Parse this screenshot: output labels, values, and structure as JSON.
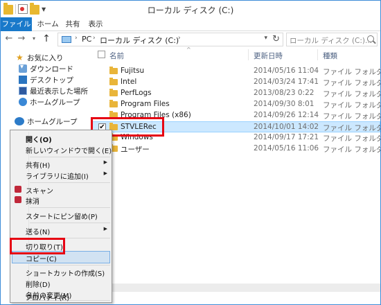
{
  "window": {
    "title": "ローカル ディスク (C:)"
  },
  "ribbon": {
    "tabs": [
      "ファイル",
      "ホーム",
      "共有",
      "表示"
    ]
  },
  "address": {
    "root_label": "PC",
    "current_label": "ローカル ディスク (C:)",
    "search_placeholder": "ローカル ディスク (C:)..."
  },
  "navpane": {
    "favorites": "お気に入り",
    "items": [
      "ダウンロード",
      "デスクトップ",
      "最近表示した場所",
      "ホームグループ"
    ],
    "homegroup": "ホームグループ"
  },
  "filelist": {
    "headers": {
      "name": "名前",
      "date": "更新日時",
      "type": "種類"
    },
    "rows": [
      {
        "name": "Fujitsu",
        "date": "2014/05/16 11:04",
        "type": "ファイル フォルダー"
      },
      {
        "name": "Intel",
        "date": "2014/03/24 17:41",
        "type": "ファイル フォルダー"
      },
      {
        "name": "PerfLogs",
        "date": "2013/08/23 0:22",
        "type": "ファイル フォルダー"
      },
      {
        "name": "Program Files",
        "date": "2014/09/30 8:01",
        "type": "ファイル フォルダー"
      },
      {
        "name": "Program Files (x86)",
        "date": "2014/09/26 12:14",
        "type": "ファイル フォルダー"
      },
      {
        "name": "STVLERec",
        "date": "2014/10/01 14:02",
        "type": "ファイル フォルダー",
        "selected": true
      },
      {
        "name": "Windows",
        "date": "2014/09/17 17:21",
        "type": "ファイル フォルダー"
      },
      {
        "name": "ユーザー",
        "date": "2014/05/16 11:06",
        "type": "ファイル フォルダー"
      }
    ]
  },
  "context_menu": {
    "items": [
      {
        "label": "開く(O)",
        "bold": true
      },
      {
        "label": "新しいウィンドウで開く(E)"
      },
      {
        "label": "共有(H)",
        "submenu": true
      },
      {
        "label": "ライブラリに追加(I)",
        "submenu": true
      },
      {
        "label": "スキャン",
        "icon": "antivirus-icon"
      },
      {
        "label": "抹消",
        "icon": "antivirus-icon"
      },
      {
        "label": "スタートにピン留め(P)"
      },
      {
        "label": "送る(N)",
        "submenu": true
      },
      {
        "label": "切り取り(T)"
      },
      {
        "label": "コピー(C)",
        "highlighted": true
      },
      {
        "label": "ショートカットの作成(S)"
      },
      {
        "label": "削除(D)"
      },
      {
        "label": "名前の変更(M)"
      },
      {
        "label": "プロパティ(R)"
      }
    ]
  },
  "colors": {
    "accent": "#1979ca",
    "highlight_box": "#e60012",
    "selection": "#cce8ff"
  }
}
